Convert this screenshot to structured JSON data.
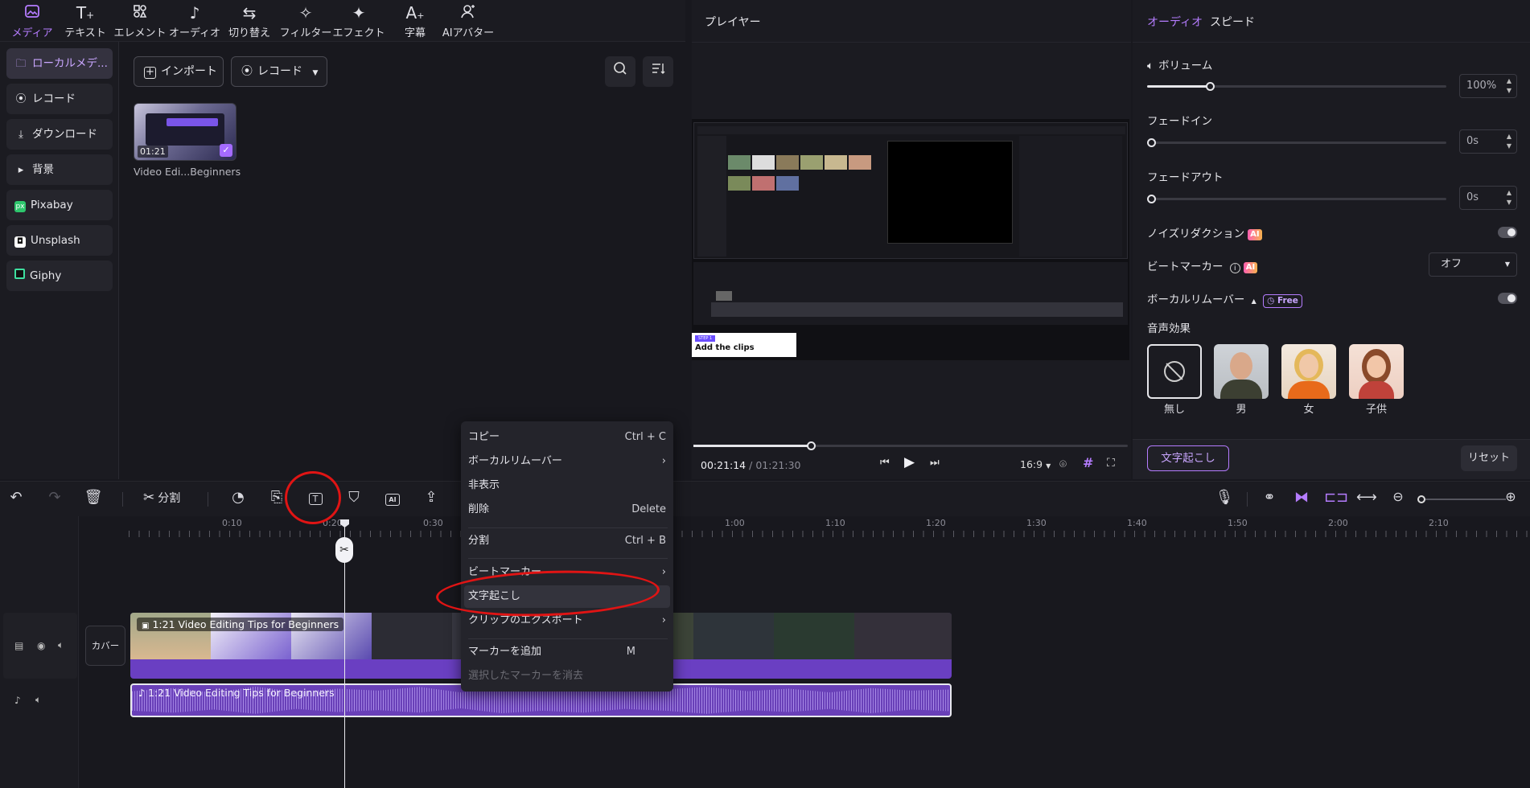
{
  "toolbar": {
    "items": [
      {
        "label": "メディア",
        "icon": "media-icon"
      },
      {
        "label": "テキスト",
        "icon": "text-icon"
      },
      {
        "label": "エレメント",
        "icon": "element-icon"
      },
      {
        "label": "オーディオ",
        "icon": "audio-icon"
      },
      {
        "label": "切り替え",
        "icon": "transition-icon"
      },
      {
        "label": "フィルター",
        "icon": "filter-icon"
      },
      {
        "label": "エフェクト",
        "icon": "effect-icon"
      },
      {
        "label": "字幕",
        "icon": "subtitle-icon"
      },
      {
        "label": "AIアバター",
        "icon": "ai-avatar-icon"
      }
    ],
    "accent": "#b57cff"
  },
  "sidebar": {
    "items": [
      {
        "label": "ローカルメデ...",
        "icon": "folder-icon"
      },
      {
        "label": "レコード",
        "icon": "record-icon"
      },
      {
        "label": "ダウンロード",
        "icon": "download-icon"
      },
      {
        "label": "背景",
        "icon": "caret-right-icon"
      },
      {
        "label": "Pixabay",
        "icon": "pixabay-icon"
      },
      {
        "label": "Unsplash",
        "icon": "unsplash-icon"
      },
      {
        "label": "Giphy",
        "icon": "giphy-icon"
      }
    ]
  },
  "media": {
    "import_label": "インポート",
    "record_label": "レコード",
    "clip_duration": "01:21",
    "clip_name": "Video Edi...Beginners"
  },
  "player": {
    "title": "プレイヤー",
    "current_time": "00:21:14",
    "separator": "/",
    "total_time": "01:21:30",
    "aspect": "16:9",
    "progress": 0.27,
    "preview_caption_tag": "STEP 1",
    "preview_caption": "Add the clips"
  },
  "audio_panel": {
    "tabs": [
      "オーディオ",
      "スピード"
    ],
    "volume_label": "ボリューム",
    "volume_value": "100%",
    "volume_level": 0.21,
    "fade_in_label": "フェードイン",
    "fade_in_value": "0s",
    "fade_out_label": "フェードアウト",
    "fade_out_value": "0s",
    "noise_label": "ノイズリダクション",
    "beat_label": "ビートマーカー",
    "beat_value": "オフ",
    "vocal_label": "ボーカルリムーバー",
    "free_badge": "Free",
    "ai_badge": "AI",
    "effects_label": "音声効果",
    "effects": [
      "無し",
      "男",
      "女",
      "子供"
    ],
    "transcribe_button": "文字起こし",
    "reset_button": "リセット"
  },
  "timeline_toolbar": {
    "split_label": "分割"
  },
  "timeline": {
    "ruler": [
      "0:10",
      "0:20",
      "0:30",
      "1:00",
      "1:10",
      "1:20",
      "1:30",
      "1:40",
      "1:50",
      "2:00",
      "2:10"
    ],
    "cover_label": "カバー",
    "video_clip_title": "1:21 Video Editing Tips for Beginners",
    "audio_clip_title": "1:21 Video Editing Tips for Beginners"
  },
  "context_menu": {
    "items": [
      {
        "label": "コピー",
        "shortcut": "Ctrl + C"
      },
      {
        "label": "ボーカルリムーバー",
        "shortcut": "›"
      },
      {
        "label": "非表示",
        "shortcut": ""
      },
      {
        "label": "削除",
        "shortcut": "Delete"
      },
      {
        "label": "分割",
        "shortcut": "Ctrl + B"
      },
      {
        "label": "ビートマーカー",
        "shortcut": "›"
      },
      {
        "label": "文字起こし",
        "shortcut": ""
      },
      {
        "label": "クリップのエクスポート",
        "shortcut": "›"
      },
      {
        "label": "マーカーを追加",
        "shortcut": "M"
      },
      {
        "label": "選択したマーカーを消去",
        "shortcut": ""
      }
    ]
  }
}
